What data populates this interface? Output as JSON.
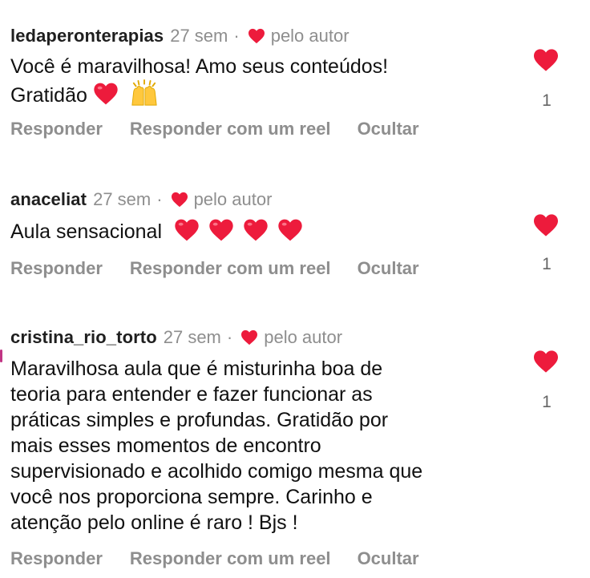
{
  "comments": [
    {
      "username": "ledaperonterapias",
      "time": "27 sem",
      "separator": "·",
      "author_label": "pelo autor",
      "text_line1": "Você é maravilhosa! Amo seus conteúdos!",
      "text_line2": "Gratidão",
      "emoji": [
        "red-heart",
        "raising-hands"
      ],
      "likes": "1",
      "actions": {
        "reply": "Responder",
        "reel": "Responder com um reel",
        "hide": "Ocultar"
      }
    },
    {
      "username": "anaceliat",
      "time": "27 sem",
      "separator": "·",
      "author_label": "pelo autor",
      "text": "Aula sensacional",
      "emoji": [
        "red-heart",
        "red-heart",
        "red-heart",
        "red-heart"
      ],
      "likes": "1",
      "actions": {
        "reply": "Responder",
        "reel": "Responder com um reel",
        "hide": "Ocultar"
      }
    },
    {
      "username": "cristina_rio_torto",
      "time": "27 sem",
      "separator": "·",
      "author_label": "pelo autor",
      "text_lines": [
        "Maravilhosa aula que é misturinha boa de",
        "teoria para entender e fazer funcionar as",
        "práticas simples e profundas. Gratidão por",
        "mais esses momentos de encontro",
        "supervisionado e acolhido comigo mesma que",
        "você nos proporciona sempre. Carinho e",
        "atenção pelo online é raro ! Bjs !"
      ],
      "likes": "1",
      "actions": {
        "reply": "Responder",
        "reel": "Responder com um reel",
        "hide": "Ocultar"
      }
    }
  ],
  "colors": {
    "heart_red": "#ed1b3c",
    "muted_text": "#8e8e8e",
    "username_text": "#1f1f1f"
  },
  "icons": {
    "author_heart": "heart-icon",
    "like_button": "heart-icon"
  }
}
